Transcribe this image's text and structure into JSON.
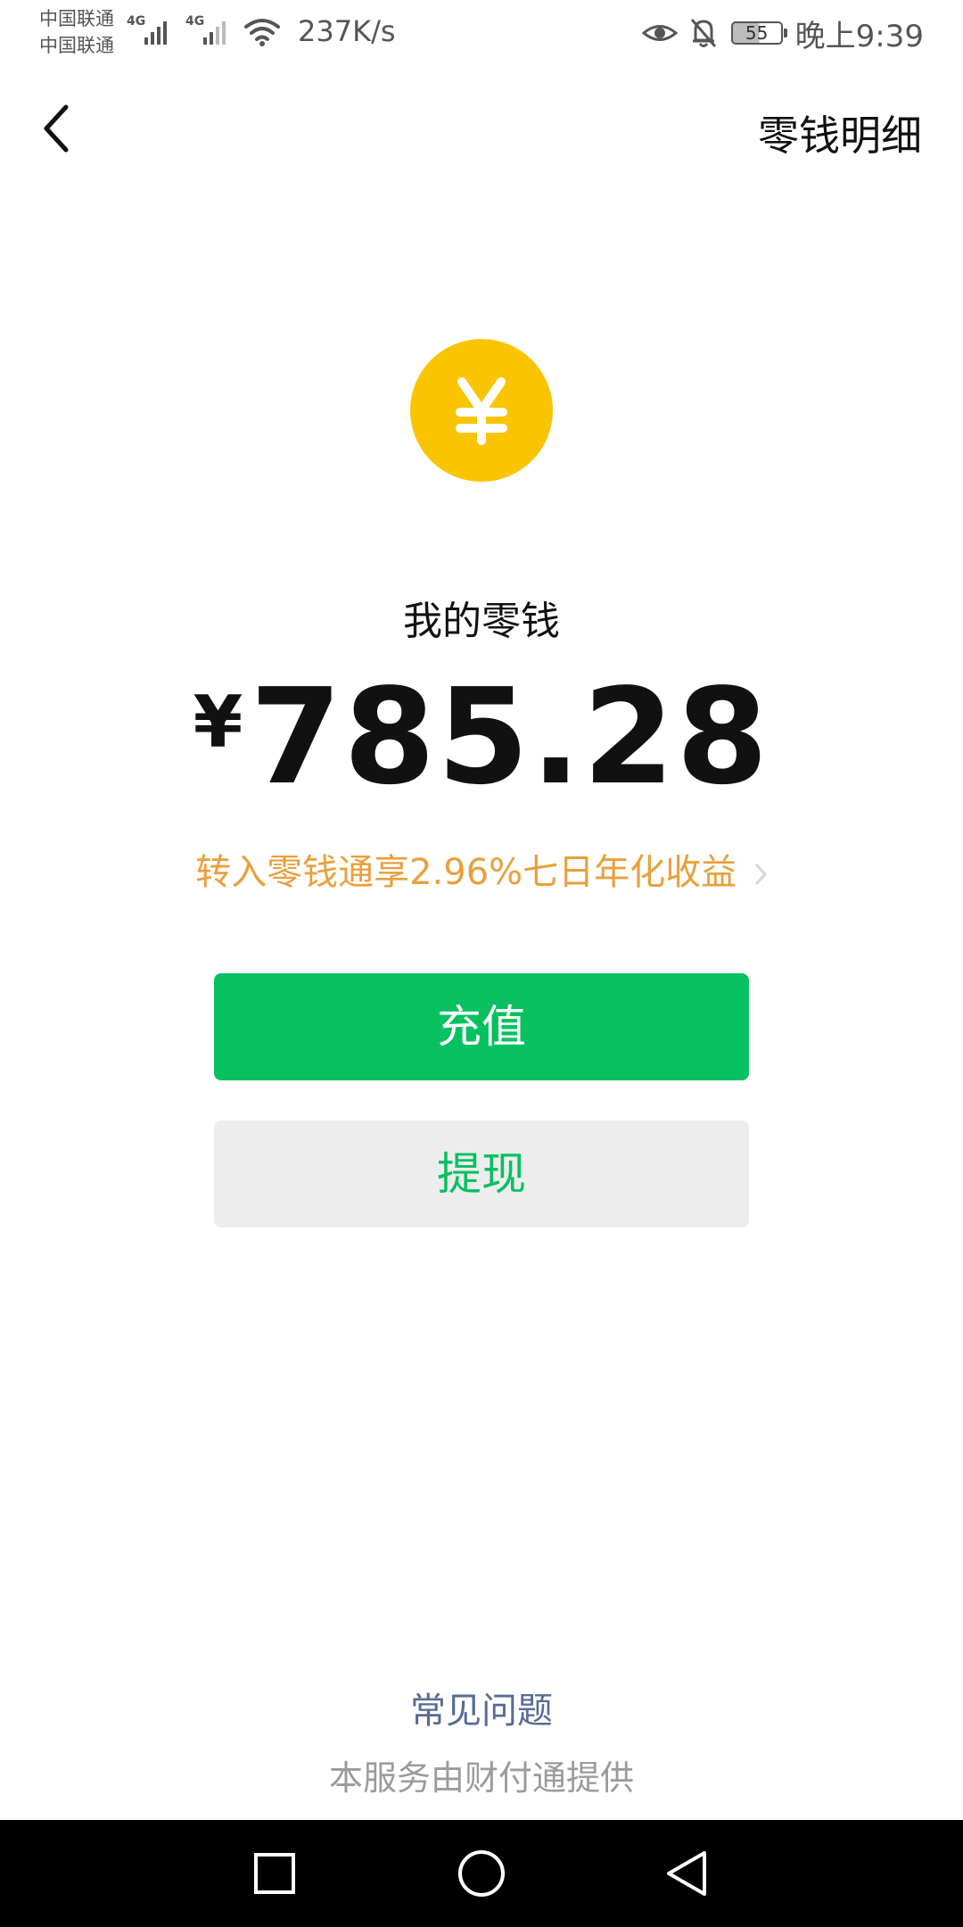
{
  "status_bar": {
    "carrier_1": "中国联通",
    "carrier_2": "中国联通",
    "network_1": "4G",
    "network_2": "4G",
    "net_speed": "237K/s",
    "battery_level": "55",
    "time": "晚上9:39"
  },
  "header": {
    "detail_link": "零钱明细"
  },
  "wallet": {
    "label": "我的零钱",
    "currency": "¥",
    "balance": "785.28",
    "promo": "转入零钱通享2.96%七日年化收益"
  },
  "actions": {
    "recharge": "充值",
    "withdraw": "提现"
  },
  "footer": {
    "faq": "常见问题",
    "provider": "本服务由财付通提供"
  },
  "colors": {
    "primary_green": "#07c160",
    "coin_yellow": "#fbc400",
    "promo_orange": "#e9a03c",
    "link_blue": "#576b95"
  },
  "icons": [
    "back-arrow-icon",
    "yen-coin-icon",
    "chevron-right-icon",
    "eye-icon",
    "bell-off-icon",
    "wifi-icon",
    "signal-icon",
    "battery-icon",
    "square-icon",
    "circle-icon",
    "triangle-back-icon"
  ]
}
